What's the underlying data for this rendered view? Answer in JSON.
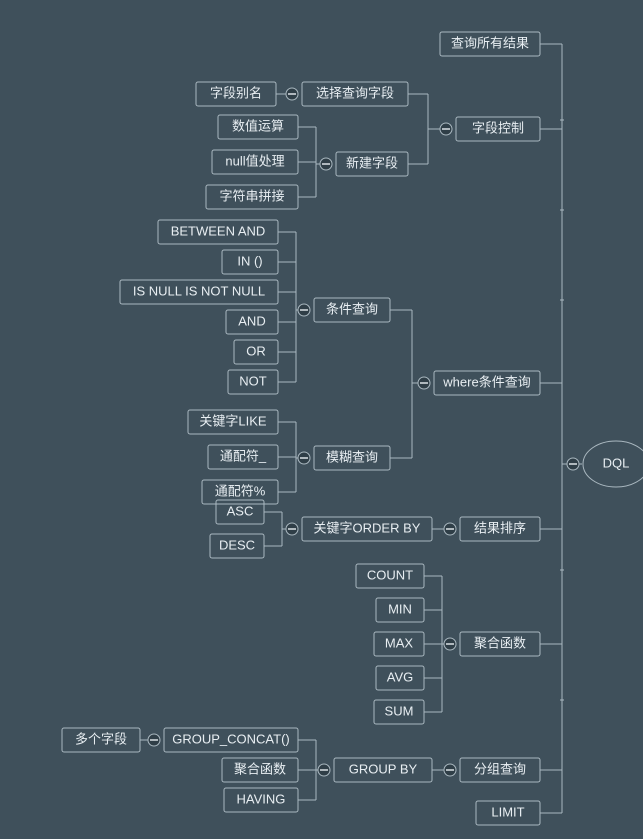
{
  "root": "DQL",
  "level1": {
    "query_all": "查询所有结果",
    "field_ctrl": "字段控制",
    "where": "where条件查询",
    "order": "结果排序",
    "agg": "聚合函数",
    "group": "分组查询",
    "limit": "LIMIT"
  },
  "field_ctrl_children": {
    "select_field": "选择查询字段",
    "new_field": "新建字段"
  },
  "select_field_children": {
    "alias": "字段别名"
  },
  "new_field_children": {
    "numeric": "数值运算",
    "null_handle": "null值处理",
    "concat": "字符串拼接"
  },
  "where_children": {
    "cond_query": "条件查询",
    "fuzzy": "模糊查询"
  },
  "cond_query_children": {
    "between": "BETWEEN AND",
    "in": "IN ()",
    "isnull": "IS NULL IS NOT NULL",
    "and": "AND",
    "or": "OR",
    "not": "NOT"
  },
  "fuzzy_children": {
    "like": "关键字LIKE",
    "wc_underscore": "通配符_",
    "wc_percent": "通配符%"
  },
  "order_children": {
    "orderby": "关键字ORDER BY",
    "asc": "ASC",
    "desc": "DESC"
  },
  "agg_children": {
    "count": "COUNT",
    "min": "MIN",
    "max": "MAX",
    "avg": "AVG",
    "sum": "SUM"
  },
  "group_children": {
    "group_by": "GROUP BY",
    "group_concat": "GROUP_CONCAT()",
    "agg_fn": "聚合函数",
    "having": "HAVING",
    "multi_fields": "多个字段"
  }
}
